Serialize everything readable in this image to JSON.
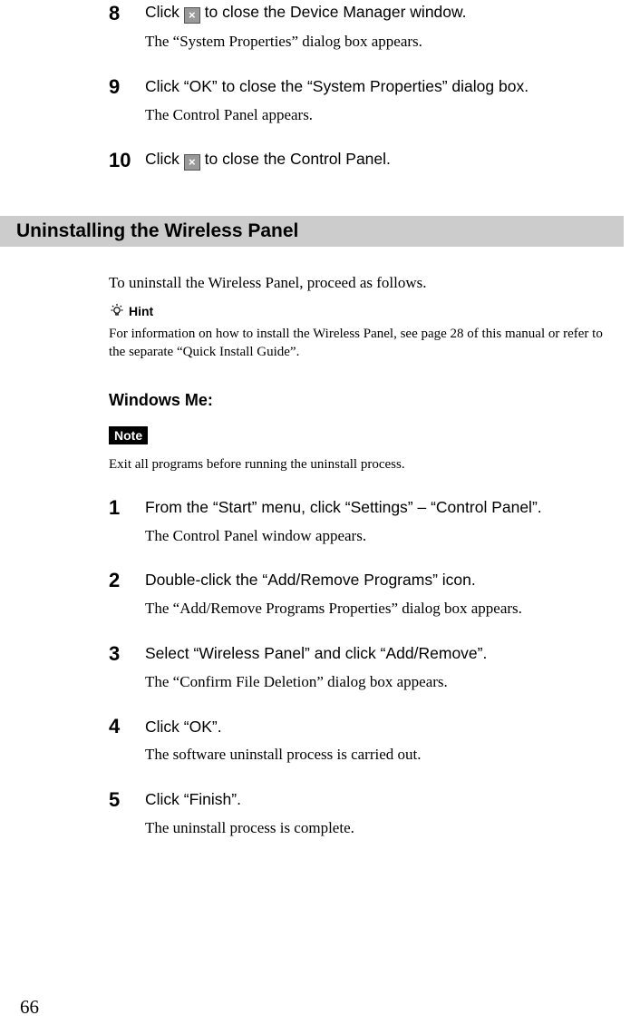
{
  "top_steps": [
    {
      "num": "8",
      "title_before": "Click ",
      "title_after": " to close the Device Manager window.",
      "has_icon": true,
      "body": "The “System Properties” dialog box appears."
    },
    {
      "num": "9",
      "title_before": "Click “OK” to close the “System Properties” dialog box.",
      "title_after": "",
      "has_icon": false,
      "body": "The Control Panel appears."
    },
    {
      "num": "10",
      "title_before": "Click ",
      "title_after": " to close the Control Panel.",
      "has_icon": true,
      "body": ""
    }
  ],
  "section_header": "Uninstalling the Wireless Panel",
  "intro_para": "To uninstall the Wireless Panel, proceed as follows.",
  "hint_label": "Hint",
  "hint_text": "For information on how to install the Wireless Panel, see page 28 of this manual or refer to the separate “Quick Install Guide”.",
  "subheading": "Windows Me:",
  "note_label": "Note",
  "note_text": "Exit all programs before running the uninstall process.",
  "steps2": [
    {
      "num": "1",
      "title": "From the “Start” menu, click “Settings” – “Control Panel”.",
      "body": "The Control Panel window appears."
    },
    {
      "num": "2",
      "title": "Double-click the “Add/Remove Programs” icon.",
      "body": "The “Add/Remove Programs Properties” dialog box appears."
    },
    {
      "num": "3",
      "title": "Select “Wireless Panel” and click “Add/Remove”.",
      "body": "The “Confirm File Deletion” dialog box appears."
    },
    {
      "num": "4",
      "title": "Click “OK”.",
      "body": "The software uninstall process is carried out."
    },
    {
      "num": "5",
      "title": "Click “Finish”.",
      "body": "The uninstall process is complete."
    }
  ],
  "page_number": "66"
}
